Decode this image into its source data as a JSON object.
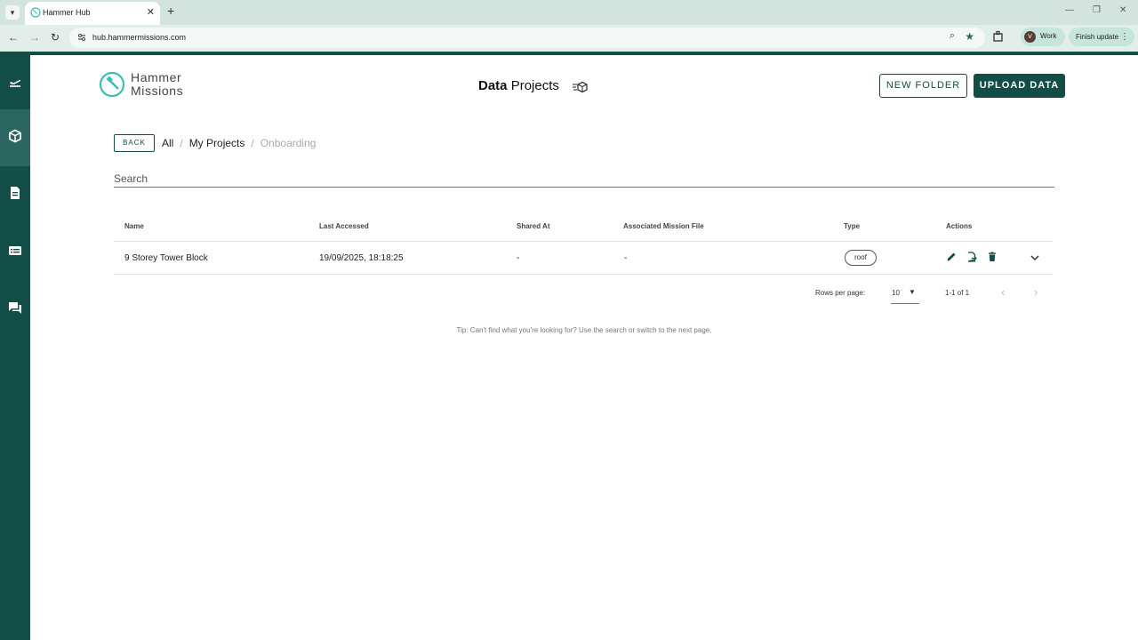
{
  "browser": {
    "tab_title": "Hammer Hub",
    "new_tab_label": "+",
    "url": "hub.hammermissions.com",
    "profile_initial": "V",
    "profile_label": "Work",
    "update_label": "Finish update"
  },
  "sidebar": {
    "items": [
      {
        "icon": "flight-icon",
        "active": false
      },
      {
        "icon": "cube-icon",
        "active": true
      },
      {
        "icon": "report-icon",
        "active": false
      },
      {
        "icon": "list-icon",
        "active": false
      },
      {
        "icon": "chat-icon",
        "active": false
      }
    ]
  },
  "header": {
    "logo_line1": "Hammer",
    "logo_line2": "Missions",
    "title_bold": "Data",
    "title_rest": "Projects",
    "new_folder_label": "NEW FOLDER",
    "upload_label": "UPLOAD DATA"
  },
  "nav": {
    "back_label": "BACK",
    "crumbs": [
      "All",
      "My Projects",
      "Onboarding"
    ],
    "separator": "/"
  },
  "search": {
    "placeholder": "Search"
  },
  "table": {
    "columns": [
      "Name",
      "Last Accessed",
      "Shared At",
      "Associated Mission File",
      "Type",
      "Actions"
    ],
    "rows": [
      {
        "name": "9 Storey Tower Block",
        "last_accessed": "19/09/2025, 18:18:25",
        "shared_at": "-",
        "mission_file": "-",
        "type": "roof"
      }
    ]
  },
  "pagination": {
    "rows_per_page_label": "Rows per page:",
    "rows_per_page_value": "10",
    "range": "1-1 of 1"
  },
  "tip": "Tip: Can't find what you're looking for? Use the search or switch to the next page.",
  "colors": {
    "brand": "#134d48",
    "sidebar_active": "#2b6660",
    "logo_accent": "#3dbfb3"
  }
}
